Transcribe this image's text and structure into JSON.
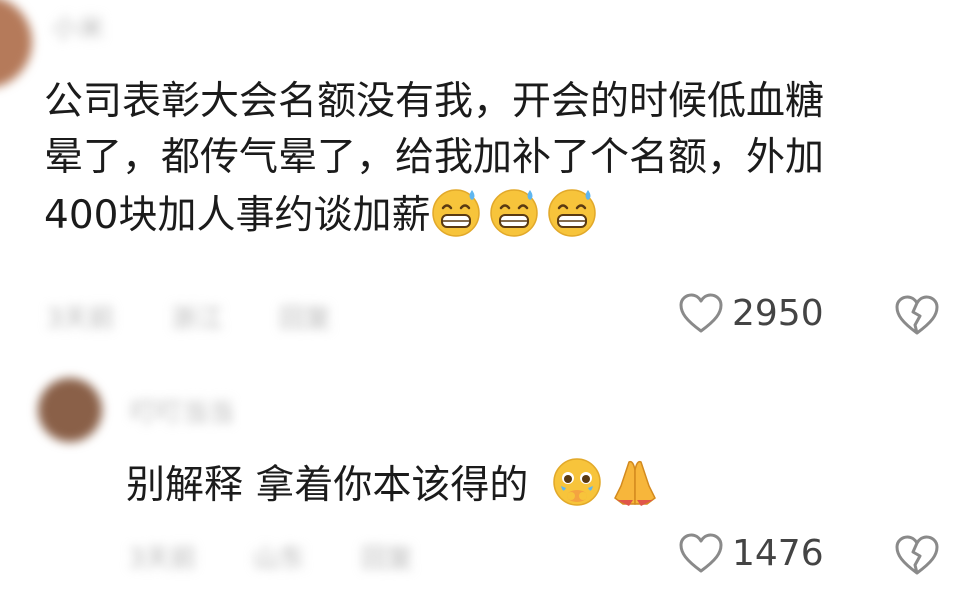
{
  "comment1": {
    "username": "小米",
    "text_lines": [
      "公司表彰大会名额没有我，开会的时候低血糖",
      "晕了，都传气晕了，给我加补了个名额，外加",
      "400块加人事约谈加薪"
    ],
    "emojis": [
      "sweat-grin-emoji",
      "sweat-grin-emoji",
      "sweat-grin-emoji"
    ],
    "meta": [
      "3天前",
      "浙江",
      "回复"
    ],
    "likes": "2950"
  },
  "comment2": {
    "username": "叮叮当当",
    "text": "别解释 拿着你本该得的",
    "emojis": [
      "pleading-face-emoji",
      "folded-hands-emoji"
    ],
    "meta": [
      "3天前",
      "山东",
      "回复"
    ],
    "likes": "1476"
  },
  "colors": {
    "emoji_yellow": "#f7c43b",
    "emoji_sweat": "#5fb6ef",
    "icon_gray": "#8a8a8a"
  }
}
